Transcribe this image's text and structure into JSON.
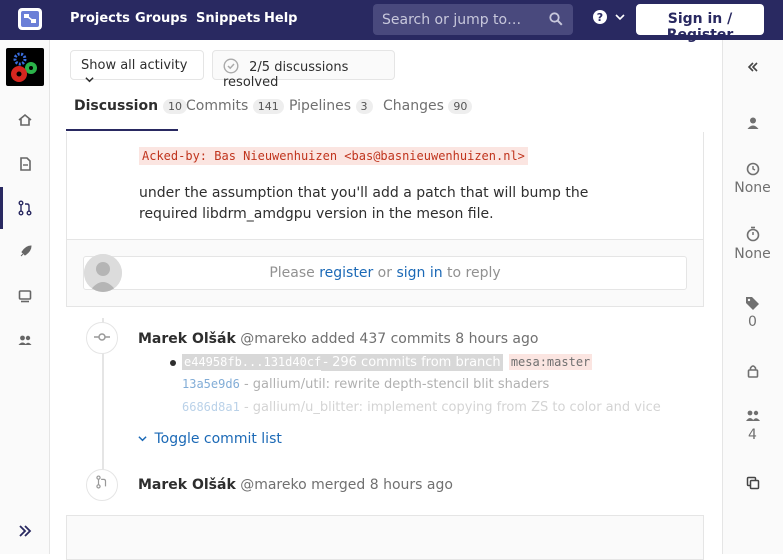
{
  "topbar": {
    "nav": [
      "Projects",
      "Groups",
      "Snippets",
      "Help"
    ],
    "search_placeholder": "Search or jump to…",
    "signin_label": "Sign in / Register"
  },
  "toolbar": {
    "activity_filter": "Show all activity",
    "discussions_resolved": "2/5 discussions resolved"
  },
  "tabs": [
    {
      "label": "Discussion",
      "count": "10"
    },
    {
      "label": "Commits",
      "count": "141"
    },
    {
      "label": "Pipelines",
      "count": "3"
    },
    {
      "label": "Changes",
      "count": "90"
    }
  ],
  "note": {
    "acked_by": "Acked-by: Bas Nieuwenhuizen <bas@basnieuwenhuizen.nl>",
    "body": "under the assumption that you'll add a patch that will bump the required libdrm_amdgpu version in the meson file.",
    "reply": {
      "prefix": "Please",
      "register": "register",
      "or": "or",
      "sign_in": "sign in",
      "suffix": "to reply"
    }
  },
  "commits_event": {
    "author": "Marek Olšák",
    "handle": "@mareko",
    "action": "added 437 commits",
    "time": "8 hours ago",
    "range": "e44958fb...131d40cf",
    "range_text": "- 296 commits from branch",
    "branch": "mesa:master",
    "commits": [
      {
        "sha": "13a5e9d6",
        "message": "- gallium/util: rewrite depth-stencil blit shaders"
      },
      {
        "sha": "6686d8a1",
        "message": "- gallium/u_blitter: implement copying from ZS to color and vice"
      }
    ],
    "toggle": "Toggle commit list"
  },
  "merge_event": {
    "author": "Marek Olšák",
    "handle": "@mareko",
    "action": "merged",
    "time": "8 hours ago"
  },
  "right_sidebar": {
    "time_estimate": "None",
    "time_spent": "None",
    "labels_count": "0",
    "participants_count": "4"
  }
}
